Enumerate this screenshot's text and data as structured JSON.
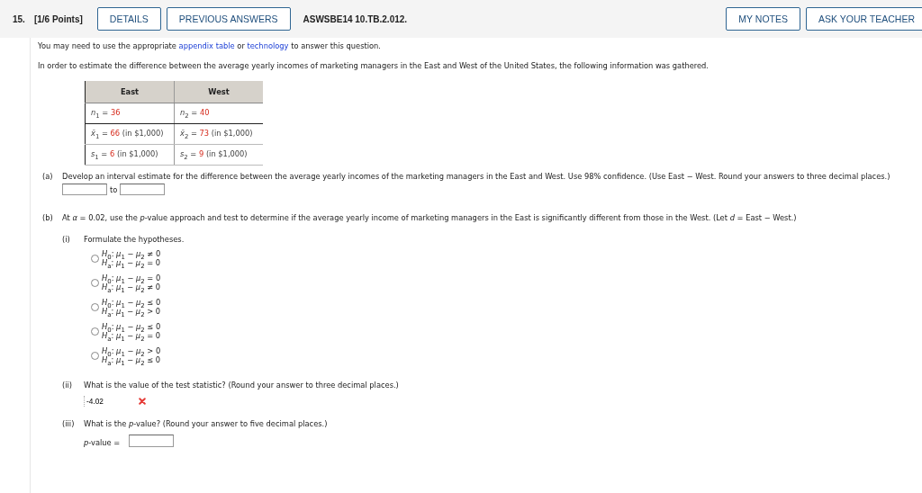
{
  "header": {
    "number": "15.",
    "points": "[1/6 Points]",
    "buttons": [
      "DETAILS",
      "PREVIOUS ANSWERS"
    ],
    "code": "ASWSBE14 10.TB.2.012.",
    "right_buttons": [
      "MY NOTES",
      "ASK YOUR TEACHER"
    ]
  },
  "intro": {
    "before": "You may need to use the appropriate",
    "link1": "appendix table",
    "middle": "or",
    "link2": "technology",
    "after": "to answer this question."
  },
  "statement": "In order to estimate the difference between the average yearly incomes of marketing managers in the East and West of the United States, the following information was gathered.",
  "table": {
    "columns": [
      "East",
      "West"
    ],
    "rows": [
      [
        {
          "symbol": "*n*$_{1}$ =",
          "value": "36"
        },
        {
          "symbol": "*n*$_{2}$ =",
          "value": "40"
        }
      ],
      [
        {
          "symbol": "*x̄*$_{1}$ =",
          "value": "66",
          "unit": "(in $1,000)"
        },
        {
          "symbol": "*x̄*$_{2}$ =",
          "value": "73",
          "unit": "(in $1,000)"
        }
      ],
      [
        {
          "symbol": "*s*$_{1}$ =",
          "value": "6",
          "unit": "(in $1,000)"
        },
        {
          "symbol": "*s*$_{2}$ =",
          "value": "9",
          "unit": "(in $1,000)"
        }
      ]
    ]
  },
  "part_a": {
    "label": "(a)",
    "text": "Develop an interval estimate for the difference between the average yearly incomes of the marketing managers in the East and West. Use 98% confidence. (Use East − West. Round your answers to three decimal places.)",
    "joiner": "to"
  },
  "part_b": {
    "label": "(b)",
    "text": "At *α* = 0.02, use the *p*-value approach and test to determine if the average yearly income of marketing managers in the East is significantly different from those in the West. (Let *d* = East − West.)",
    "sub_i": {
      "label": "(i)",
      "text": "Formulate the hypotheses.",
      "options": [
        {
          "h0": "*H*$_{0}$: *μ*$_{1}$ − *μ*$_{2}$ ≠ 0",
          "ha": "*H*$_{a}$: *μ*$_{1}$ − *μ*$_{2}$ = 0",
          "selected": false
        },
        {
          "h0": "*H*$_{0}$: *μ*$_{1}$ − *μ*$_{2}$ = 0",
          "ha": "*H*$_{a}$: *μ*$_{1}$ − *μ*$_{2}$ ≠ 0",
          "selected": false
        },
        {
          "h0": "*H*$_{0}$: *μ*$_{1}$ − *μ*$_{2}$ ≤ 0",
          "ha": "*H*$_{a}$: *μ*$_{1}$ − *μ*$_{2}$ > 0",
          "selected": false
        },
        {
          "h0": "*H*$_{0}$: *μ*$_{1}$ − *μ*$_{2}$ ≤ 0",
          "ha": "*H*$_{a}$: *μ*$_{1}$ − *μ*$_{2}$ = 0",
          "selected": false
        },
        {
          "h0": "*H*$_{0}$: *μ*$_{1}$ − *μ*$_{2}$ > 0",
          "ha": "*H*$_{a}$: *μ*$_{1}$ − *μ*$_{2}$ ≤ 0",
          "selected": false
        }
      ]
    },
    "sub_ii": {
      "label": "(ii)",
      "text": "What is the value of the test statistic? (Round your answer to three decimal places.)",
      "value": "-4.02",
      "correct": false
    },
    "sub_iii": {
      "label": "(iii)",
      "text": "What is the *p*-value? (Round your answer to five decimal places.)",
      "field_label": "*p*-value ="
    }
  }
}
